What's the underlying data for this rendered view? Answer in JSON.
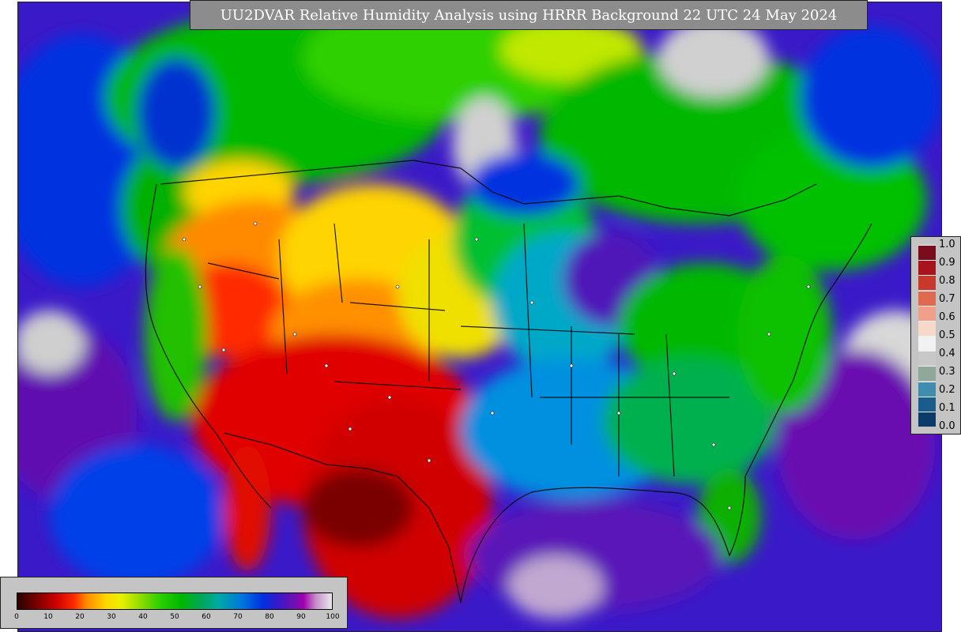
{
  "title": "UU2DVAR Relative Humidity Analysis using HRRR Background 22 UTC 24 May 2024",
  "rh_legend": {
    "ticks": [
      "1.0",
      "0.9",
      "0.8",
      "0.7",
      "0.6",
      "0.5",
      "0.4",
      "0.3",
      "0.2",
      "0.1",
      "0.0"
    ],
    "colors": [
      "#7a0c1c",
      "#a8141c",
      "#c8392c",
      "#e06a50",
      "#f0a08a",
      "#f8d8c8",
      "#f2f2f2",
      "#c8c8c8",
      "#8ea89a",
      "#3f8cae",
      "#1a5c8e",
      "#0c3a6a"
    ]
  },
  "pct_legend": {
    "ticks": [
      "0",
      "10",
      "20",
      "30",
      "40",
      "50",
      "60",
      "70",
      "80",
      "90",
      "100"
    ]
  },
  "colors": {
    "ocean": "#3a19c8",
    "dry": "#d00000",
    "moist": "#00b800",
    "land_blue": "#0090e0",
    "ice": "#d0d0d0"
  }
}
